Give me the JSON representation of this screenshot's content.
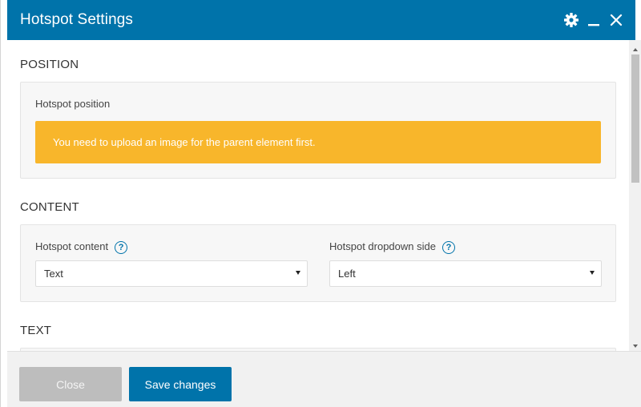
{
  "window": {
    "title": "Hotspot Settings",
    "controls": [
      {
        "name": "gear-icon"
      },
      {
        "name": "minimize-icon"
      },
      {
        "name": "close-icon"
      }
    ]
  },
  "sections": {
    "position": {
      "title": "POSITION",
      "field_label": "Hotspot position",
      "notice": "You need to upload an image for the parent element first."
    },
    "content": {
      "title": "CONTENT",
      "hotspot_content": {
        "label": "Hotspot content",
        "help": "?",
        "value": "Text"
      },
      "dropdown_side": {
        "label": "Hotspot dropdown side",
        "help": "?",
        "value": "Left"
      }
    },
    "text": {
      "title": "TEXT"
    }
  },
  "footer": {
    "close_label": "Close",
    "save_label": "Save changes"
  },
  "colors": {
    "accent": "#0073aa",
    "notice": "#f8b62b",
    "disabled": "#bdbdbd"
  }
}
